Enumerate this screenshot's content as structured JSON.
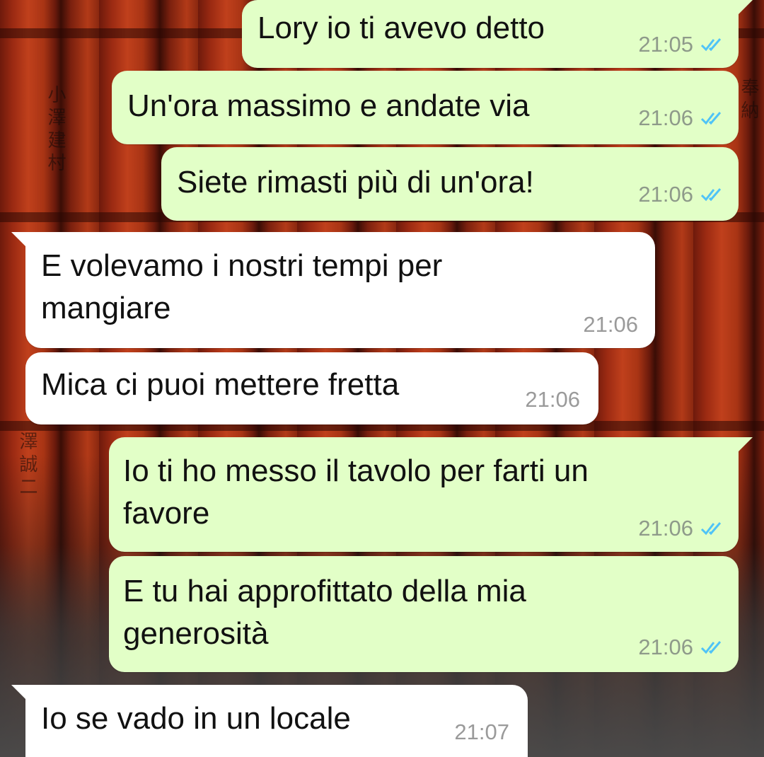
{
  "colors": {
    "outgoing_bubble": "#e2ffc7",
    "incoming_bubble": "#ffffff",
    "read_ticks": "#4fc3f7"
  },
  "messages": [
    {
      "direction": "outgoing",
      "text": "Lory io ti avevo detto",
      "time": "21:05",
      "status_icon": "double-check-read-icon"
    },
    {
      "direction": "outgoing",
      "text": "Un'ora massimo e andate via",
      "time": "21:06",
      "status_icon": "double-check-read-icon"
    },
    {
      "direction": "outgoing",
      "text": "Siete rimasti più di un'ora!",
      "time": "21:06",
      "status_icon": "double-check-read-icon"
    },
    {
      "direction": "incoming",
      "text": "E volevamo i nostri tempi per\nmangiare",
      "time": "21:06"
    },
    {
      "direction": "incoming",
      "text": "Mica ci puoi mettere fretta",
      "time": "21:06"
    },
    {
      "direction": "outgoing",
      "text": "Io ti ho messo il tavolo per farti un\nfavore",
      "time": "21:06",
      "status_icon": "double-check-read-icon"
    },
    {
      "direction": "outgoing",
      "text": "E tu hai approfittato della mia\ngenerosità",
      "time": "21:06",
      "status_icon": "double-check-read-icon"
    },
    {
      "direction": "incoming",
      "text": "Io se vado in un locale",
      "time": "21:07"
    }
  ]
}
